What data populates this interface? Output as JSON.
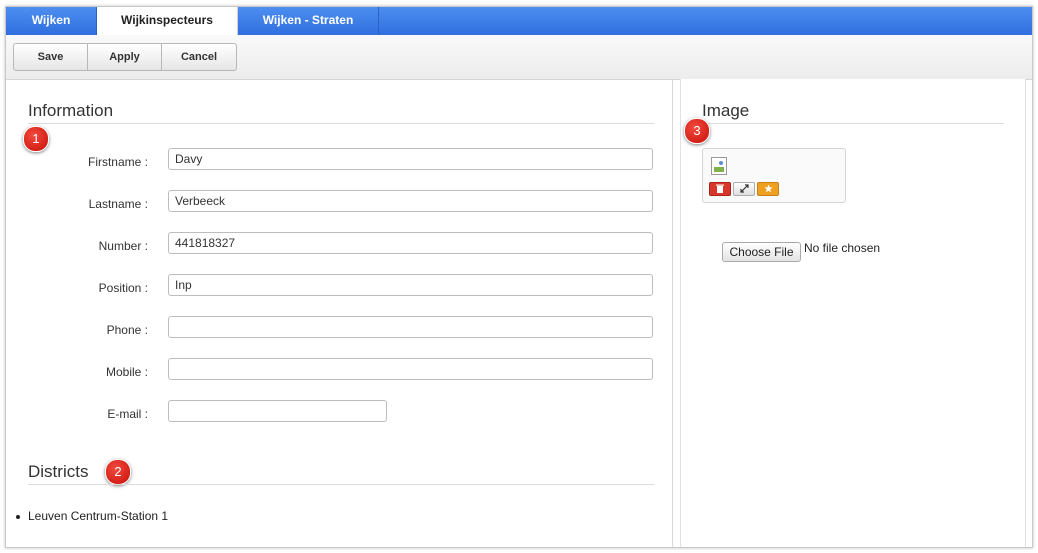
{
  "tabs": [
    {
      "label": "Wijken"
    },
    {
      "label": "Wijkinspecteurs"
    },
    {
      "label": "Wijken - Straten"
    }
  ],
  "active_tab": "Wijkinspecteurs",
  "toolbar": {
    "save_label": "Save",
    "apply_label": "Apply",
    "cancel_label": "Cancel"
  },
  "information": {
    "title": "Information",
    "marker": "1",
    "fields": {
      "firstname": {
        "label": "Firstname :",
        "value": "Davy"
      },
      "lastname": {
        "label": "Lastname :",
        "value": "Verbeeck"
      },
      "number": {
        "label": "Number :",
        "value": "441818327"
      },
      "position": {
        "label": "Position :",
        "value": "Inp"
      },
      "phone": {
        "label": "Phone :",
        "value": ""
      },
      "mobile": {
        "label": "Mobile :",
        "value": ""
      },
      "email": {
        "label": "E-mail :",
        "value": ""
      }
    }
  },
  "districts": {
    "title": "Districts",
    "marker": "2",
    "items": [
      "Leuven Centrum-Station 1"
    ]
  },
  "image": {
    "title": "Image",
    "marker": "3",
    "choose_file_label": "Choose File",
    "no_file_text": "No file chosen",
    "icons": [
      "trash-icon",
      "resize-icon",
      "star-icon"
    ]
  },
  "colors": {
    "tab_bar": "#2f6fde",
    "marker_red": "#d4180f",
    "delete_red": "#d8362c",
    "star_orange": "#f0a020"
  }
}
